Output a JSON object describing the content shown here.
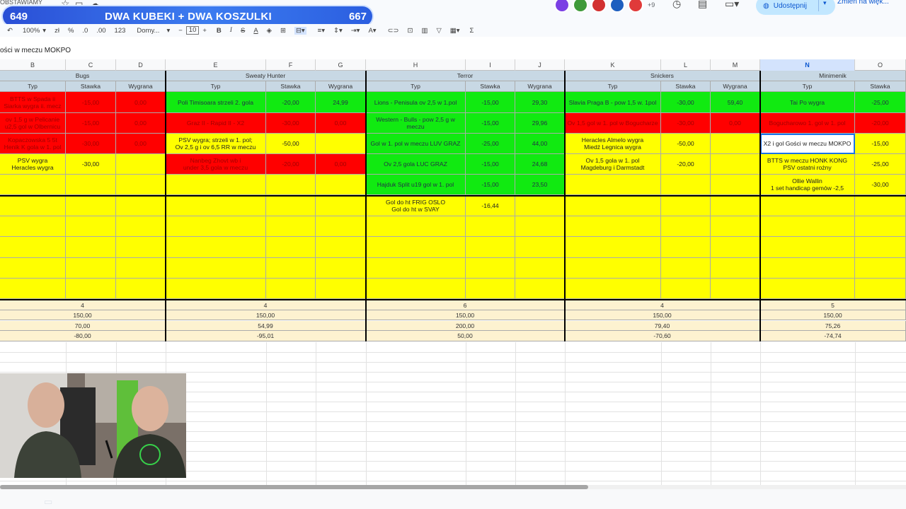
{
  "header": {
    "banner_top_text": "OBSTAWIAMY",
    "banner_left": "649",
    "banner_title": "DWA KUBEKI + DWA KOSZULKI",
    "banner_right": "667",
    "extra_users": "+9",
    "share_label": "Udostępnij",
    "mode_label": "Zmień na więk..."
  },
  "toolbar": {
    "undo": "↶",
    "print": "⎙",
    "zoom": "100%",
    "currency": "zł",
    "percent": "%",
    "dec_minus": ".0",
    "dec_plus": ".00",
    "format_123": "123",
    "font_name": "Domy...",
    "minus": "−",
    "font_size": "10",
    "plus": "+",
    "bold": "B",
    "italic": "I",
    "strike": "S",
    "underline": "A",
    "sigma": "Σ"
  },
  "formula_bar": {
    "text": "ości w meczu MOKPO"
  },
  "columns": [
    "B",
    "C",
    "D",
    "E",
    "F",
    "G",
    "H",
    "I",
    "J",
    "K",
    "L",
    "M",
    "N",
    "O"
  ],
  "players": [
    "Bugs",
    "Sweaty Hunter",
    "Terror",
    "Snickers",
    "Minimenik"
  ],
  "subheaders": {
    "typ": "Typ",
    "stawka": "Stawka",
    "wygrana": "Wygrana"
  },
  "bugs": [
    {
      "typ": "BTTS w Spada ii\nSiarka wygra ii. mecz",
      "stawka": "-15,00",
      "wygrana": "0,00"
    },
    {
      "typ": "ov 1,5 g w Pelicanie\nu2,5 gol w Olbernicu",
      "stawka": "-15,00",
      "wygrana": "0,00"
    },
    {
      "typ": "Kopaczowska 5 5t\nHenik K gola w 1. pol",
      "stawka": "-30,00",
      "wygrana": "0,00"
    },
    {
      "typ": "PSV wygra\nHeracles wygra",
      "stawka": "-30,00",
      "wygrana": ""
    }
  ],
  "sweaty": [
    {
      "typ": "Poli Timisoara strzeli 2. gola",
      "stawka": "-20,00",
      "wygrana": "24,99"
    },
    {
      "typ": "Graz II - Rapid II - X2",
      "stawka": "-30,00",
      "wygrana": "0,00"
    },
    {
      "typ": "PSV wygra; strzeli w 1. pol;\nOv 2,5 g i ov 6,5 RR w meczu",
      "stawka": "-50,00",
      "wygrana": ""
    },
    {
      "typ": "Nanbeg Zhovt wb i\nunder 3,5 gola w meczu",
      "stawka": "-20,00",
      "wygrana": "0,00"
    }
  ],
  "terror": [
    {
      "typ": "Lions - Penisula ov 2,5 w 1.pol",
      "stawka": "-15,00",
      "wygrana": "29,30"
    },
    {
      "typ": "Western - Bulls - pow 2,5 g w meczu",
      "stawka": "-15,00",
      "wygrana": "29,96"
    },
    {
      "typ": "Gol w 1. pol w meczu LUV GRAZ",
      "stawka": "-25,00",
      "wygrana": "44,00"
    },
    {
      "typ": "Ov 2,5 gola LUC GRAZ",
      "stawka": "-15,00",
      "wygrana": "24,68"
    },
    {
      "typ": "Hajduk Split u19 gol w 1. pol",
      "stawka": "-15,00",
      "wygrana": "23,50"
    },
    {
      "typ": "Gol do ht FRIG OSLO\nGol do ht w SVAY",
      "stawka": "-16,44",
      "wygrana": ""
    }
  ],
  "snickers": [
    {
      "typ": "Slavia Praga B - pow 1,5 w. 1pol",
      "stawka": "-30,00",
      "wygrana": "59,40"
    },
    {
      "typ": "Ov 1,5 gol w 1. pol w Bogucharze",
      "stawka": "-30,00",
      "wygrana": "0,00"
    },
    {
      "typ": "Heracles Almelo wygra\nMiedź Legnica wygra",
      "stawka": "-50,00",
      "wygrana": ""
    },
    {
      "typ": "Ov 1,5 gola w 1. pol\nMagdeburg i Darmstadt",
      "stawka": "-20,00",
      "wygrana": ""
    }
  ],
  "minimenik": [
    {
      "typ": "Tai Po wygra",
      "stawka": "-25,00"
    },
    {
      "typ": "Bogucharowo 1. gol w 1. pol",
      "stawka": "-20,00"
    },
    {
      "typ": "X2 i gol Gości w meczu MOKPO",
      "stawka": "-15,00"
    },
    {
      "typ": "BTTS w meczu HONK KONG\nPSV ostatni rożny",
      "stawka": "-25,00"
    },
    {
      "typ": "Ollie Wallin\n1 set handicap gemów -2,5",
      "stawka": "-30,00"
    }
  ],
  "summary": {
    "count": [
      "4",
      "4",
      "6",
      "4",
      "5"
    ],
    "bankroll": [
      "150,00",
      "150,00",
      "150,00",
      "150,00",
      "150,00"
    ],
    "won": [
      "70,00",
      "54,99",
      "200,00",
      "79,40",
      "75,26"
    ],
    "balance": [
      "-80,00",
      "-95,01",
      "50,00",
      "-70,60",
      "-74,74"
    ]
  },
  "colors": {
    "red": "#ff0000",
    "green": "#11ea11",
    "yellow": "#ffff00",
    "header": "#c8d8e4",
    "summary": "#fdf2d0",
    "banner": "#2f63e4"
  }
}
